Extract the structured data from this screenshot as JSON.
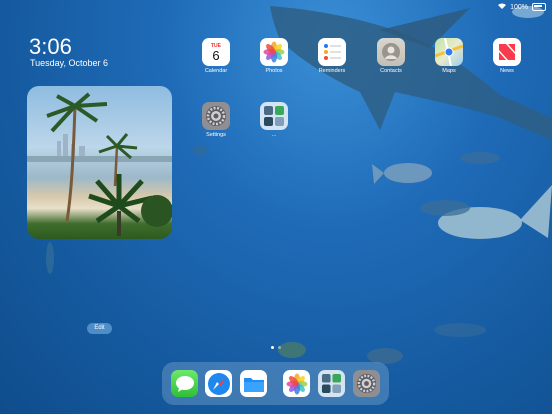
{
  "status": {
    "battery": "100%"
  },
  "lockinfo": {
    "time": "3:06",
    "date": "Tuesday, October 6"
  },
  "apps": {
    "calendar": {
      "label": "Calendar",
      "day": "TUE",
      "num": "6"
    },
    "photos": {
      "label": "Photos"
    },
    "reminders": {
      "label": "Reminders"
    },
    "contacts": {
      "label": "Contacts"
    },
    "maps": {
      "label": "Maps"
    },
    "news": {
      "label": "News"
    },
    "settings": {
      "label": "Settings"
    },
    "folder": {
      "label": "..."
    }
  },
  "edit_label": "Edit",
  "dock": {
    "apps": [
      "Messages",
      "Safari",
      "Files",
      "Photos",
      "Folder",
      "Settings"
    ]
  },
  "page_indicator": {
    "pages": 2,
    "current": 1
  }
}
